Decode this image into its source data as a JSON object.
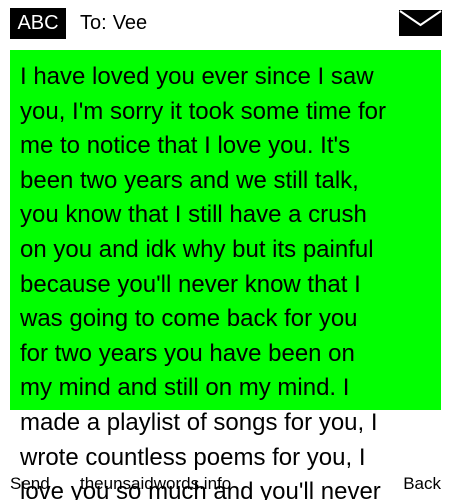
{
  "header": {
    "input_mode": "ABC",
    "to_label": "To:",
    "recipient": "Vee",
    "envelope_icon": "envelope-icon"
  },
  "message": {
    "highlight_color": "#00ff00",
    "text": "I have loved you ever since I saw\nyou, I'm sorry it took some time for\nme to notice that I love you. It's\nbeen two years and we still talk,\nyou know that I still have a crush\non you and idk why but its painful\nbecause you'll never know that I\nwas going to come back for you\nfor two years you have been on\nmy mind and still on my mind. I\nmade a playlist of songs for you, I\nwrote countless poems for you, I\nlove you so much and you'll never"
  },
  "softkeys": {
    "left": "Send",
    "center": "theunsaidwords.info",
    "right": "Back"
  }
}
